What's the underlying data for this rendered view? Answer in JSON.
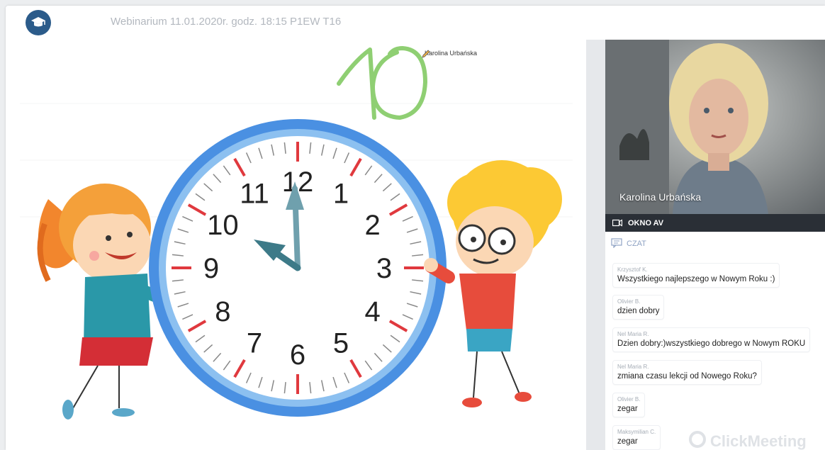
{
  "header": {
    "title": "Webinarium 11.01.2020r. godz. 18:15 P1EW T16"
  },
  "whiteboard": {
    "annotation_number": "10",
    "annotation_author": "Karolina Urbańska",
    "clock_numbers": [
      "12",
      "1",
      "2",
      "3",
      "4",
      "5",
      "6",
      "7",
      "8",
      "9",
      "10",
      "11"
    ]
  },
  "video": {
    "presenter_name": "Karolina Urbańska",
    "window_label": "OKNO AV"
  },
  "chat": {
    "label": "CZAT",
    "messages": [
      {
        "author": "Krzysztof K.",
        "text": "Wszystkiego najlepszego w Nowym Roku :)"
      },
      {
        "author": "Olivier B.",
        "text": "dzien dobry"
      },
      {
        "author": "Nel Maria R.",
        "text": "Dzien dobry:)wszystkiego dobrego w Nowym ROKU"
      },
      {
        "author": "Nel Maria R.",
        "text": "zmiana czasu lekcji od Nowego Roku?"
      },
      {
        "author": "Olivier B.",
        "text": "zegar"
      },
      {
        "author": "Maksymilian C.",
        "text": "zegar"
      }
    ]
  },
  "branding": {
    "watermark": "ClickMeeting"
  },
  "colors": {
    "accent_blue": "#2b5b8a",
    "clock_ring": "#4a90e2",
    "annotation_green": "#8fcf73",
    "hand_color": "#6fa0ad",
    "tick_red": "#e0393e"
  }
}
